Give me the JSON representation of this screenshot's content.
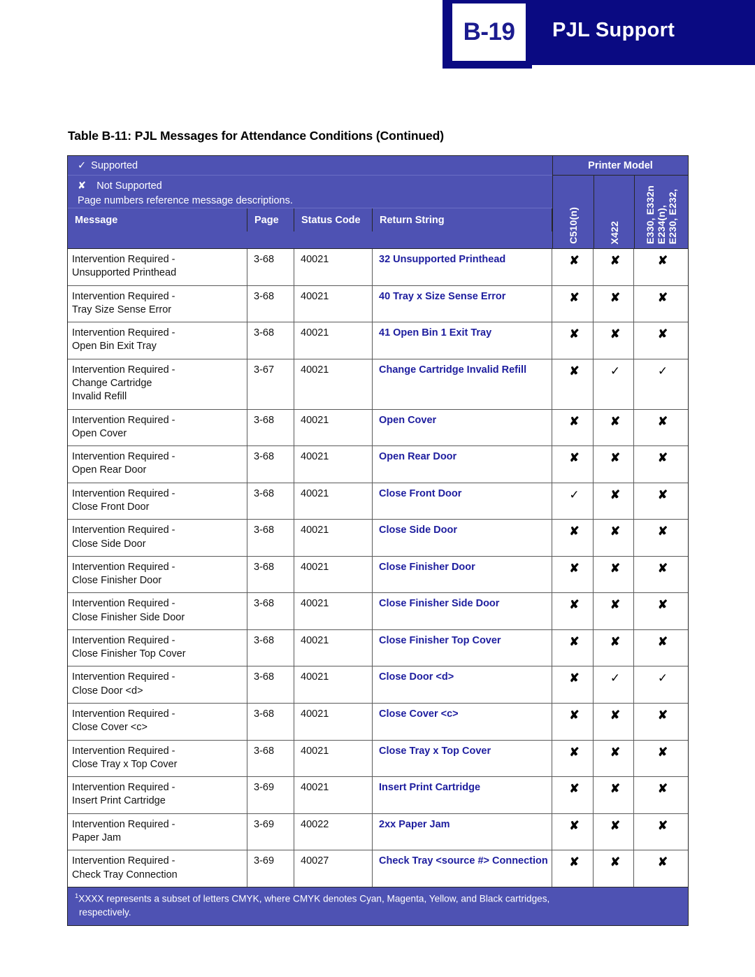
{
  "banner": {
    "page_number": "B-19",
    "title": "PJL Support"
  },
  "table_caption": "Table B-11:  PJL Messages for Attendance Conditions (Continued)",
  "legend": {
    "supported_mark": "✓",
    "supported_label": "Supported",
    "not_supported_mark": "✘",
    "not_supported_label": "Not Supported",
    "note": "Page numbers reference message descriptions.",
    "printer_model_header": "Printer Model"
  },
  "model_columns": [
    {
      "label": "C510(n)"
    },
    {
      "label": "X422"
    },
    {
      "label_lines": [
        "E230, E232,",
        "E234(n),",
        "E330, E332n"
      ]
    }
  ],
  "columns": {
    "message": "Message",
    "page": "Page",
    "status_code": "Status Code",
    "return_string": "Return String"
  },
  "colors": {
    "banner_blue": "#0a0a82",
    "header_purple": "#4e52b3",
    "return_string_blue": "#1d1d9e",
    "page_number_text": "#1b1b8f"
  },
  "rows": [
    {
      "message": "Intervention Required - Unsupported Printhead",
      "message_lines": [
        "Intervention Required -",
        "Unsupported Printhead"
      ],
      "page": "3-68",
      "status_code": "40021",
      "return_string": "32 Unsupported Printhead",
      "marks": [
        "✘",
        "✘",
        "✘"
      ]
    },
    {
      "message": "Intervention Required - Tray Size Sense Error",
      "message_lines": [
        "Intervention Required -",
        "Tray Size Sense Error"
      ],
      "page": "3-68",
      "status_code": "40021",
      "return_string": "40 Tray x Size Sense Error",
      "marks": [
        "✘",
        "✘",
        "✘"
      ]
    },
    {
      "message": "Intervention Required - Open Bin Exit Tray",
      "message_lines": [
        "Intervention Required -",
        "Open Bin Exit Tray"
      ],
      "page": "3-68",
      "status_code": "40021",
      "return_string": "41 Open Bin 1 Exit Tray",
      "marks": [
        "✘",
        "✘",
        "✘"
      ]
    },
    {
      "message": "Intervention Required - Change Cartridge Invalid Refill",
      "message_lines": [
        "Intervention Required -",
        "Change Cartridge",
        "Invalid Refill"
      ],
      "page": "3-67",
      "status_code": "40021",
      "return_string": "Change Cartridge Invalid Refill",
      "marks": [
        "✘",
        "✓",
        "✓"
      ]
    },
    {
      "message": "Intervention Required - Open Cover",
      "message_lines": [
        "Intervention Required -",
        "Open Cover"
      ],
      "page": "3-68",
      "status_code": "40021",
      "return_string": "Open Cover",
      "marks": [
        "✘",
        "✘",
        "✘"
      ]
    },
    {
      "message": "Intervention Required - Open Rear Door",
      "message_lines": [
        "Intervention Required -",
        "Open Rear Door"
      ],
      "page": "3-68",
      "status_code": "40021",
      "return_string": "Open Rear Door",
      "marks": [
        "✘",
        "✘",
        "✘"
      ]
    },
    {
      "message": "Intervention Required - Close Front Door",
      "message_lines": [
        "Intervention Required -",
        "Close Front Door"
      ],
      "page": "3-68",
      "status_code": "40021",
      "return_string": "Close Front Door",
      "marks": [
        "✓",
        "✘",
        "✘"
      ]
    },
    {
      "message": "Intervention Required - Close Side Door",
      "message_lines": [
        "Intervention Required -",
        "Close Side Door"
      ],
      "page": "3-68",
      "status_code": "40021",
      "return_string": "Close Side Door",
      "marks": [
        "✘",
        "✘",
        "✘"
      ]
    },
    {
      "message": "Intervention Required - Close Finisher Door",
      "message_lines": [
        "Intervention Required -",
        "Close Finisher Door"
      ],
      "page": "3-68",
      "status_code": "40021",
      "return_string": "Close Finisher Door",
      "marks": [
        "✘",
        "✘",
        "✘"
      ]
    },
    {
      "message": "Intervention Required - Close Finisher Side Door",
      "message_lines": [
        "Intervention Required -",
        "Close Finisher Side Door"
      ],
      "page": "3-68",
      "status_code": "40021",
      "return_string": "Close Finisher Side Door",
      "marks": [
        "✘",
        "✘",
        "✘"
      ]
    },
    {
      "message": "Intervention Required - Close Finisher Top Cover",
      "message_lines": [
        "Intervention Required -",
        "Close Finisher Top Cover"
      ],
      "page": "3-68",
      "status_code": "40021",
      "return_string": "Close Finisher Top Cover",
      "marks": [
        "✘",
        "✘",
        "✘"
      ]
    },
    {
      "message": "Intervention Required - Close Door <d>",
      "message_lines": [
        "Intervention Required -",
        "Close Door <d>"
      ],
      "page": "3-68",
      "status_code": "40021",
      "return_string": "Close Door <d>",
      "marks": [
        "✘",
        "✓",
        "✓"
      ]
    },
    {
      "message": "Intervention Required - Close Cover <c>",
      "message_lines": [
        "Intervention Required -",
        "Close Cover <c>"
      ],
      "page": "3-68",
      "status_code": "40021",
      "return_string": "Close Cover <c>",
      "marks": [
        "✘",
        "✘",
        "✘"
      ]
    },
    {
      "message": "Intervention Required - Close Tray x Top Cover",
      "message_lines": [
        "Intervention Required -",
        "Close Tray x Top Cover"
      ],
      "page": "3-68",
      "status_code": "40021",
      "return_string": "Close Tray x Top Cover",
      "marks": [
        "✘",
        "✘",
        "✘"
      ]
    },
    {
      "message": "Intervention Required - Insert Print Cartridge",
      "message_lines": [
        "Intervention Required -",
        "Insert Print Cartridge"
      ],
      "page": "3-69",
      "status_code": "40021",
      "return_string": "Insert Print Cartridge",
      "marks": [
        "✘",
        "✘",
        "✘"
      ]
    },
    {
      "message": "Intervention Required - Paper Jam",
      "message_lines": [
        "Intervention Required -",
        "Paper Jam"
      ],
      "page": "3-69",
      "status_code": "40022",
      "return_string": "2xx Paper Jam",
      "marks": [
        "✘",
        "✘",
        "✘"
      ]
    },
    {
      "message": "Intervention Required - Check Tray Connection",
      "message_lines": [
        "Intervention Required -",
        "Check Tray Connection"
      ],
      "page": "3-69",
      "status_code": "40027",
      "return_string": "Check Tray <source #> Connection",
      "marks": [
        "✘",
        "✘",
        "✘"
      ]
    }
  ],
  "footnote": {
    "marker": "1",
    "line1": "XXXX represents a subset of letters CMYK, where CMYK denotes Cyan, Magenta, Yellow, and Black cartridges,",
    "line2": "respectively."
  }
}
